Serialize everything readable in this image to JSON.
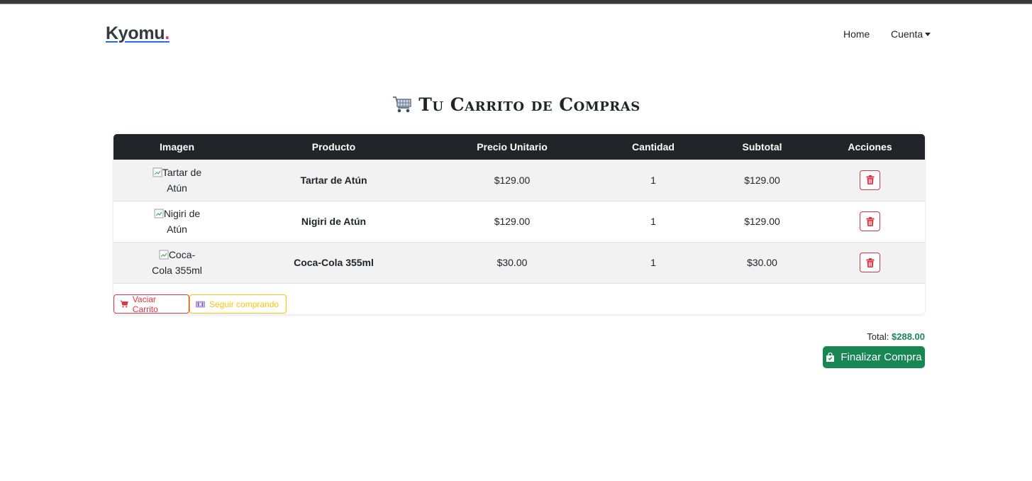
{
  "brand": {
    "name": "Kyomu",
    "dot": "."
  },
  "nav": {
    "home": "Home",
    "account": "Cuenta"
  },
  "page": {
    "title": "Tu Carrito de Compras"
  },
  "table": {
    "headers": [
      "Imagen",
      "Producto",
      "Precio Unitario",
      "Cantidad",
      "Subtotal",
      "Acciones"
    ],
    "rows": [
      {
        "image_alt": "Tartar de Atún",
        "product": "Tartar de Atún",
        "unit_price": "$129.00",
        "quantity": "1",
        "subtotal": "$129.00"
      },
      {
        "image_alt": "Nigiri de Atún",
        "product": "Nigiri de Atún",
        "unit_price": "$129.00",
        "quantity": "1",
        "subtotal": "$129.00"
      },
      {
        "image_alt": "Coca-Cola 355ml",
        "product": "Coca-Cola 355ml",
        "unit_price": "$30.00",
        "quantity": "1",
        "subtotal": "$30.00"
      }
    ]
  },
  "actions": {
    "empty_cart": "Vaciar Carrito",
    "continue_shopping": "Seguir comprando"
  },
  "summary": {
    "total_label": "Total:",
    "total_value": "$288.00",
    "checkout": "Finalizar Compra"
  },
  "icons": {
    "cart_title": "shopping-cart-icon",
    "delete": "trash-icon",
    "empty": "cart-icon",
    "continue": "utensils-icon",
    "checkout": "shopping-bag-icon"
  },
  "colors": {
    "danger": "#dc3545",
    "warning": "#ffc107",
    "success": "#198754",
    "dark": "#212529"
  }
}
